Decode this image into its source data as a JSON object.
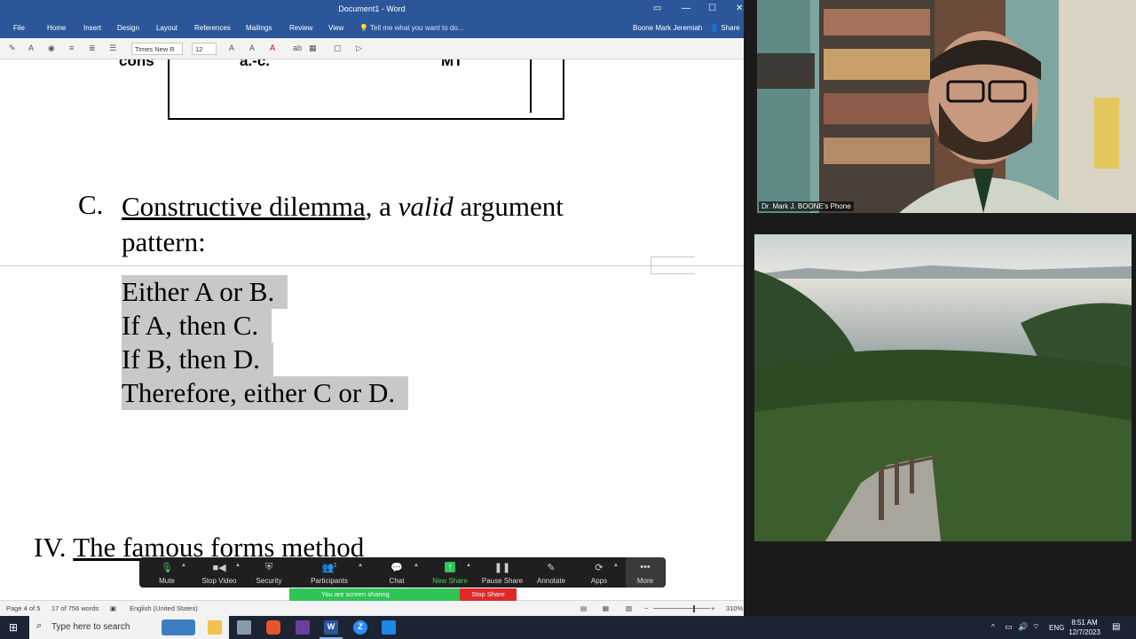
{
  "word": {
    "window_title": "Document1 - Word",
    "menu": [
      "File",
      "Home",
      "Insert",
      "Design",
      "Layout",
      "References",
      "Mailings",
      "Review",
      "View"
    ],
    "tell_me": "Tell me what you want to do...",
    "user_name": "Boone Mark Jeremiah",
    "share_label": "Share",
    "font_name": "Times New R",
    "font_size": "12",
    "doc": {
      "table_fragment_1": "cons",
      "table_fragment_2": "a.-c.",
      "table_fragment_3": "MT",
      "section_c_marker": "C.",
      "section_c_underlined": "Constructive dilemma",
      "section_c_mid": ", a ",
      "section_c_italic": "valid",
      "section_c_end": " argument pattern:",
      "argument_lines": [
        "Either A or B.",
        "If A, then C.",
        "If B, then D.",
        "Therefore, either C or D."
      ],
      "section_iv_marker": "IV.",
      "section_iv_title": "The famous forms method"
    },
    "status": {
      "page": "Page 4 of 5",
      "words": "17 of 756 words",
      "language": "English (United States)",
      "zoom": "310%"
    }
  },
  "zoom_meeting": {
    "toolbar": [
      {
        "label": "Mute",
        "icon": "mic-icon"
      },
      {
        "label": "Stop Video",
        "icon": "video-icon"
      },
      {
        "label": "Security",
        "icon": "shield-icon"
      },
      {
        "label": "Participants",
        "icon": "participants-icon",
        "count": "1"
      },
      {
        "label": "Chat",
        "icon": "chat-icon"
      },
      {
        "label": "New Share",
        "icon": "share-arrow-icon"
      },
      {
        "label": "Pause Share",
        "icon": "pause-icon"
      },
      {
        "label": "Annotate",
        "icon": "pencil-icon"
      },
      {
        "label": "Apps",
        "icon": "apps-icon"
      },
      {
        "label": "More",
        "icon": "more-icon"
      }
    ],
    "sharing_text": "You are screen sharing",
    "stop_share": "Stop Share",
    "participant_label": "Dr. Mark J. BOONE's Phone"
  },
  "taskbar": {
    "search_placeholder": "Type here to search",
    "language": "ENG",
    "time": "8:51 AM",
    "date": "12/7/2023"
  }
}
